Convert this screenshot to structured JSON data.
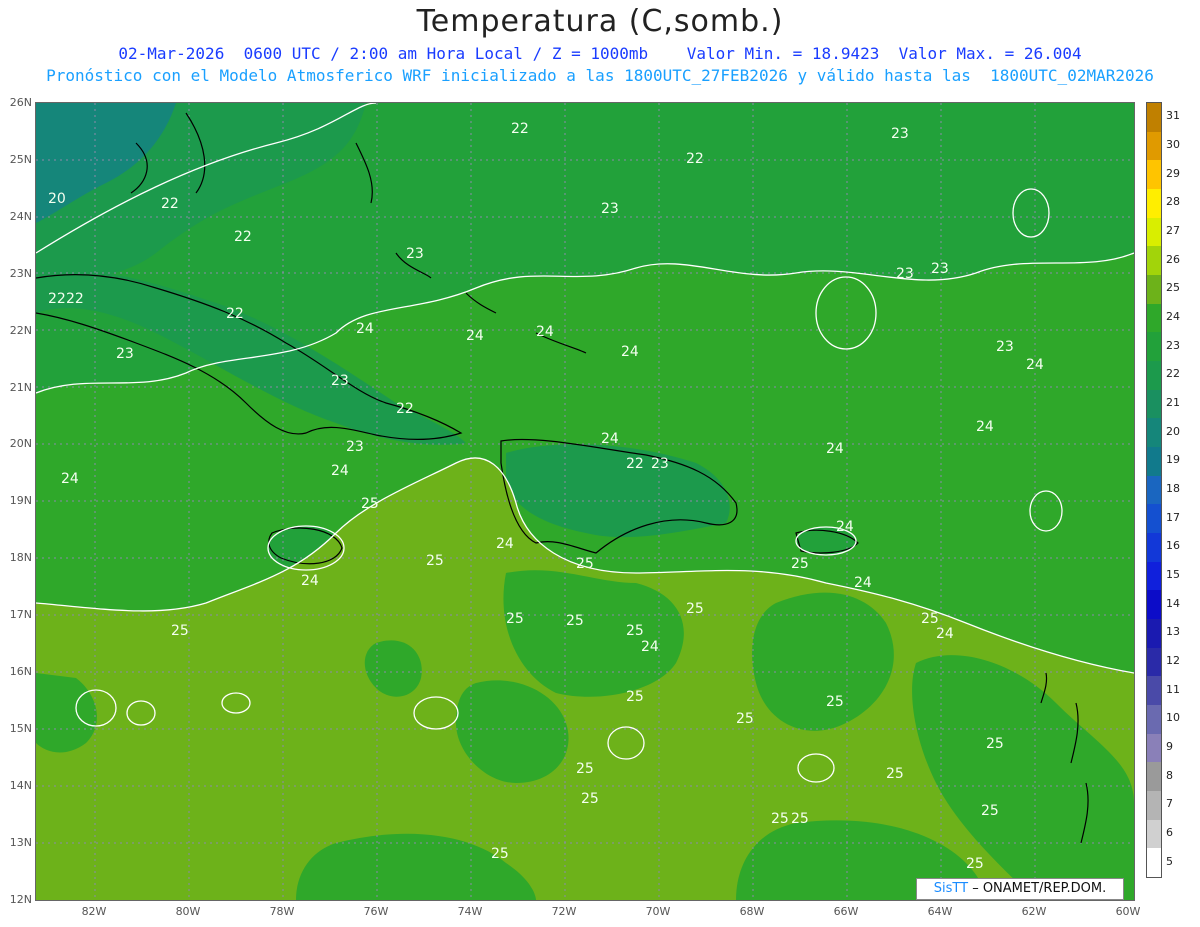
{
  "title": "Temperatura (C,somb.)",
  "subtitle1": "02-Mar-2026  0600 UTC / 2:00 am Hora Local / Z = 1000mb    Valor Min. = 18.9423  Valor Max. = 26.004",
  "subtitle2": "Pronóstico con el Modelo Atmosferico WRF inicializado a las 1800UTC_27FEB2026 y válido hasta las  1800UTC_02MAR2026",
  "lat_labels": [
    "26N",
    "25N",
    "24N",
    "23N",
    "22N",
    "21N",
    "20N",
    "19N",
    "18N",
    "17N",
    "16N",
    "15N",
    "14N",
    "13N",
    "12N"
  ],
  "lon_labels": [
    "82W",
    "80W",
    "78W",
    "76W",
    "74W",
    "72W",
    "70W",
    "68W",
    "66W",
    "64W",
    "62W",
    "60W"
  ],
  "colorbar": {
    "levels": [
      "31",
      "30",
      "29",
      "28",
      "27",
      "26",
      "25",
      "24",
      "23",
      "22",
      "21",
      "20",
      "19",
      "18",
      "17",
      "16",
      "15",
      "14",
      "13",
      "12",
      "11",
      "10",
      "9",
      "8",
      "7",
      "6",
      "5"
    ],
    "colors": [
      "#c08000",
      "#e09a00",
      "#ffc400",
      "#ffee00",
      "#d9ee00",
      "#a2d40a",
      "#6db21a",
      "#2fa82a",
      "#22a13a",
      "#1c9a4c",
      "#1a9060",
      "#15867a",
      "#117a8c",
      "#1a66c0",
      "#1450d0",
      "#1238d8",
      "#1020dc",
      "#0c0cc8",
      "#1a1ab0",
      "#2a2aa8",
      "#4a4aa8",
      "#6a6ab0",
      "#8a80b8",
      "#9a9a9a",
      "#b4b4b4",
      "#d0d0d0",
      "#ffffff"
    ]
  },
  "contour_labels": [
    "20",
    "22",
    "22",
    "22",
    "22",
    "22",
    "22",
    "22",
    "22",
    "22",
    "23",
    "23",
    "23",
    "23",
    "23",
    "23",
    "23",
    "23",
    "23",
    "23",
    "24",
    "24",
    "24",
    "24",
    "24",
    "24",
    "24",
    "24",
    "24",
    "24",
    "24",
    "24",
    "24",
    "24",
    "24",
    "24",
    "25",
    "25",
    "25",
    "25",
    "25",
    "25",
    "25",
    "25",
    "25",
    "25",
    "25",
    "25",
    "25",
    "25",
    "25",
    "25",
    "25",
    "25",
    "25",
    "25",
    "25",
    "25"
  ],
  "credit": {
    "brand": "SisTT",
    "text": " – ONAMET/REP.DOM."
  }
}
